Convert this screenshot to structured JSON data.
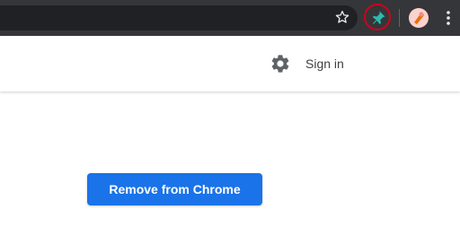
{
  "toolbar": {
    "bookmark_icon": "star-outline-icon",
    "extension_icon": "pin-icon",
    "extension_highlight_color": "#d0021b",
    "avatar_icon": "user-avatar",
    "menu_icon": "kebab-menu-icon"
  },
  "header": {
    "settings_icon": "gear-icon",
    "sign_in_label": "Sign in"
  },
  "main": {
    "remove_button_label": "Remove from Chrome",
    "accent_color": "#1a73e8"
  }
}
